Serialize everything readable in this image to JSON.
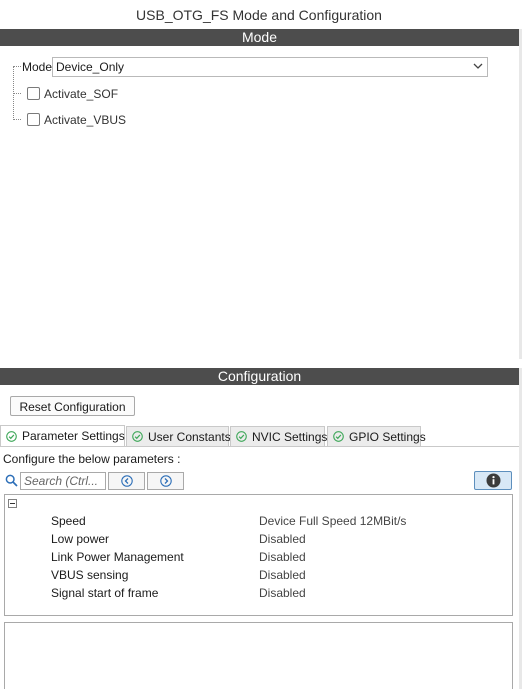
{
  "window": {
    "title": "USB_OTG_FS Mode and Configuration"
  },
  "mode_section": {
    "header": "Mode",
    "mode_label": "Mode",
    "mode_value": "Device_Only",
    "checkboxes": [
      {
        "label": "Activate_SOF",
        "checked": false
      },
      {
        "label": "Activate_VBUS",
        "checked": false
      }
    ]
  },
  "config_section": {
    "header": "Configuration",
    "reset_label": "Reset Configuration",
    "tabs": [
      {
        "label": "Parameter Settings",
        "active": true
      },
      {
        "label": "User Constants",
        "active": false
      },
      {
        "label": "NVIC Settings",
        "active": false
      },
      {
        "label": "GPIO Settings",
        "active": false
      }
    ],
    "description": "Configure the below parameters :",
    "search_placeholder": "Search (Ctrl...",
    "parameters": [
      {
        "name": "Speed",
        "value": "Device Full Speed 12MBit/s"
      },
      {
        "name": "Low power",
        "value": "Disabled"
      },
      {
        "name": "Link Power Management",
        "value": "Disabled"
      },
      {
        "name": "VBUS sensing",
        "value": "Disabled"
      },
      {
        "name": "Signal start of frame",
        "value": "Disabled"
      }
    ]
  },
  "colors": {
    "section_bar": "#4d4d4d",
    "tab_check": "#3fa85a",
    "nav_arrow": "#2d6fb8",
    "info_button": "#d8e8f6"
  }
}
